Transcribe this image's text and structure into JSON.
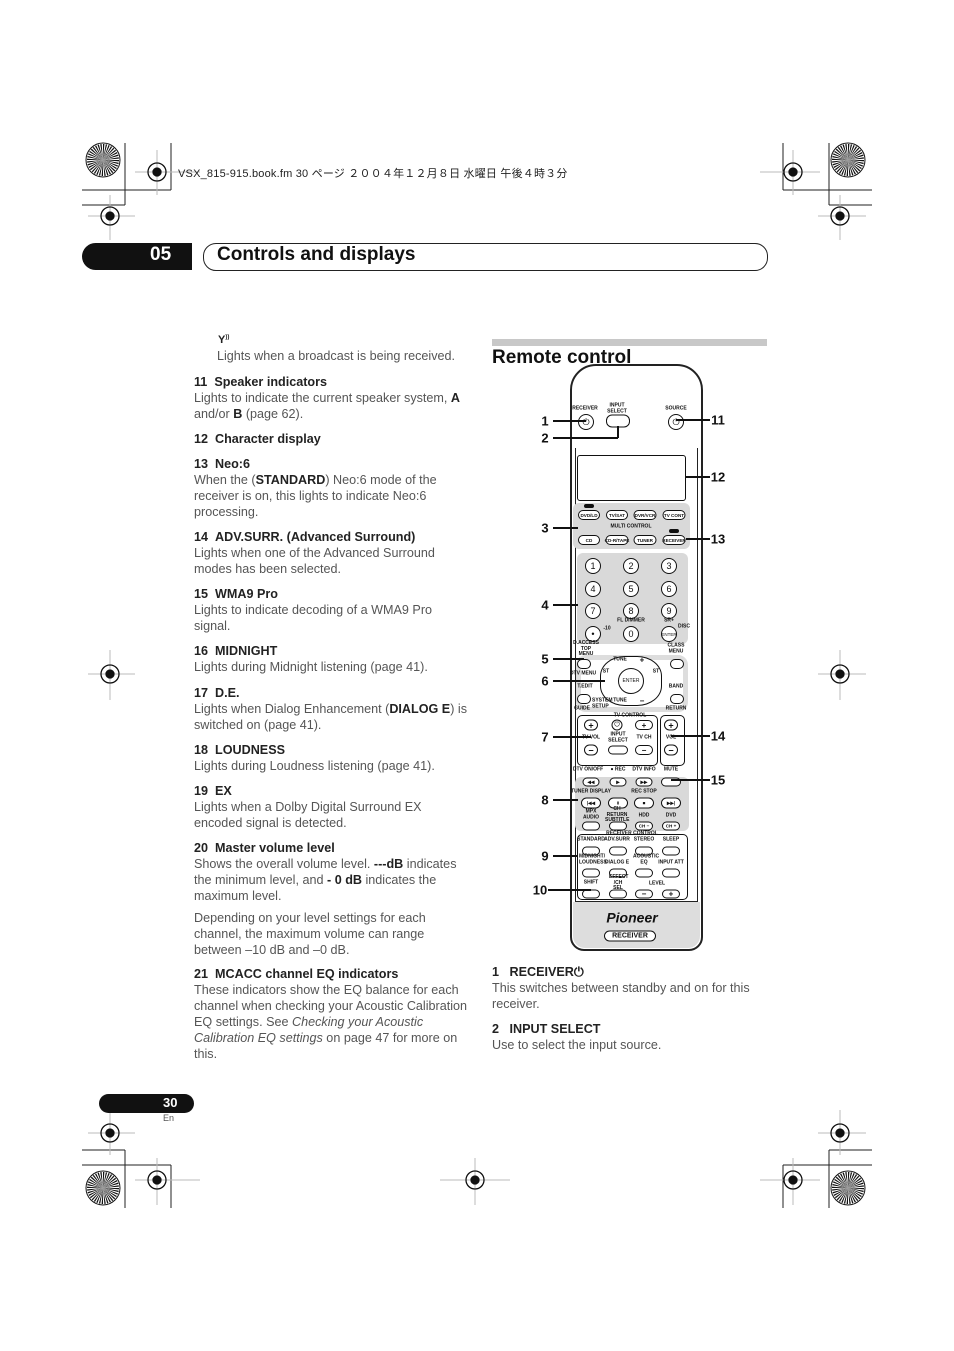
{
  "header": {
    "file_info": "VSX_815-915.book.fm  30 ページ  ２００４年１２月８日  水曜日  午後４時３分",
    "chapter_number": "05",
    "chapter_title": "Controls and displays"
  },
  "left": {
    "antenna_icon": "antenna-signal-icon",
    "antenna_text": "Lights when a broadcast is being received.",
    "items": [
      {
        "num": "11",
        "title": "Speaker indicators",
        "body": [
          "Lights to indicate the current speaker system, ",
          "A",
          " and/or ",
          "B",
          " (page 62)."
        ]
      },
      {
        "num": "12",
        "title": "Character display"
      },
      {
        "num": "13",
        "title": "Neo:6",
        "body": [
          "When the (",
          "STANDARD",
          ") Neo:6 mode of the receiver is on, this lights to indicate Neo:6 processing."
        ]
      },
      {
        "num": "14",
        "title": "ADV.SURR. (Advanced Surround)",
        "body": [
          "Lights when one of the Advanced Surround modes has been selected."
        ]
      },
      {
        "num": "15",
        "title": "WMA9 Pro",
        "body": [
          "Lights to indicate decoding of a WMA9 Pro signal."
        ]
      },
      {
        "num": "16",
        "title": "MIDNIGHT",
        "body": [
          "Lights during Midnight listening (page 41)."
        ]
      },
      {
        "num": "17",
        "title": "D.E.",
        "body": [
          "Lights when Dialog Enhancement (",
          "DIALOG E",
          ") is switched on (page 41)."
        ]
      },
      {
        "num": "18",
        "title": "LOUDNESS",
        "body": [
          "Lights during Loudness listening (page 41)."
        ]
      },
      {
        "num": "19",
        "title": "EX",
        "body": [
          "Lights when a Dolby Digital Surround EX encoded signal is detected."
        ]
      },
      {
        "num": "20",
        "title": "Master volume level",
        "body": [
          "Shows the overall volume level. ",
          "---dB",
          " indicates the minimum level, and ",
          "- 0 dB",
          " indicates the maximum level."
        ],
        "body2": "Depending on your level settings for each channel, the maximum volume can range between –10 dB and –0 dB."
      },
      {
        "num": "21",
        "title": "MCACC channel EQ indicators",
        "body": [
          "These indicators show the EQ balance for each channel when checking your Acoustic Calibration EQ settings. See ",
          "Checking your Acoustic Calibration EQ settings",
          " on page 47 for more on this."
        ]
      }
    ]
  },
  "right": {
    "section_title": "Remote control",
    "items": [
      {
        "num": "1",
        "title": "RECEIVER",
        "title_icon": "power-icon",
        "body": "This switches between standby and on for this receiver."
      },
      {
        "num": "2",
        "title": "INPUT SELECT",
        "body": "Use to select the input source."
      }
    ]
  },
  "remote": {
    "callouts": [
      "1",
      "2",
      "3",
      "4",
      "5",
      "6",
      "7",
      "8",
      "9",
      "10",
      "11",
      "12",
      "13",
      "14",
      "15"
    ],
    "labels": {
      "receiver": "RECEIVER",
      "input_select": "INPUT SELECT",
      "source": "SOURCE",
      "dvd_ld": "DVD/LD",
      "tv_sat": "TV/SAT",
      "dvr_vcr": "DVR/VCR",
      "tv_cont": "TV CONT",
      "multi_control": "MULTI CONTROL",
      "cd": "CD",
      "cdr_tape": "CD-R/TAPE",
      "tuner": "TUNER",
      "receiver_btn": "RECEIVER",
      "n1": "1",
      "n2": "2",
      "n3": "3",
      "n4": "4",
      "n5": "5",
      "n6": "6",
      "n7": "7",
      "n8": "8",
      "n9": "9",
      "dot": "•",
      "n0": "0",
      "enter_num": "ENTER",
      "minus10": "-10",
      "fl_dimmer": "FL DIMMER",
      "sr": "SR+",
      "disc": "DISC",
      "d_access": "D.ACCESS TOP MENU",
      "class_menu": "CLASS MENU",
      "dtv_menu": "DTV MENU",
      "enter": "ENTER",
      "tune_up": "TUNE",
      "tune_down": "TUNE",
      "st_left": "ST",
      "st_right": "ST",
      "t_edit": "T.EDIT",
      "guide": "GUIDE",
      "system_setup": "SYSTEM SETUP",
      "band": "BAND",
      "return": "RETURN",
      "tv_control": "TV CONTROL",
      "tv_vol": "TV VOL",
      "tv_input_select": "INPUT SELECT",
      "tv_ch": "TV CH",
      "vol": "VOL",
      "plus": "+",
      "minus": "−",
      "dtv_onoff": "DTV ON/OFF",
      "rec": "● REC",
      "dtv_info": "DTV INFO",
      "mute": "MUTE",
      "rew": "◀◀",
      "play": "▶",
      "ff": "▶▶",
      "tuner_display": "TUNER DISPLAY",
      "rec_stop": "REC STOP",
      "prev": "|◀◀",
      "pause": "II",
      "stop": "■",
      "next": "▶▶|",
      "mpx_audio": "MPX AUDIO",
      "ch_return": "CH RETURN SUBTITLE",
      "hdd": "HDD",
      "dvd": "DVD",
      "ch_minus": "CH −",
      "ch_plus": "CH +",
      "receiver_control": "RECEIVER CONTROL",
      "standard": "STANDARD",
      "adv_surr": "ADV.SURR",
      "stereo": "STEREO",
      "sleep": "SLEEP",
      "midnight": "MIDNIGHT/ LOUDNESS",
      "dialog_e": "DIALOG E",
      "acoustic_eq": "ACOUSTIC EQ",
      "input_att": "INPUT ATT",
      "shift": "SHIFT",
      "effect": "EFFECT /CH SEL",
      "level": "LEVEL",
      "brand": "Pioneer",
      "model": "RECEIVER"
    }
  },
  "footer": {
    "page_number": "30",
    "language": "En"
  }
}
